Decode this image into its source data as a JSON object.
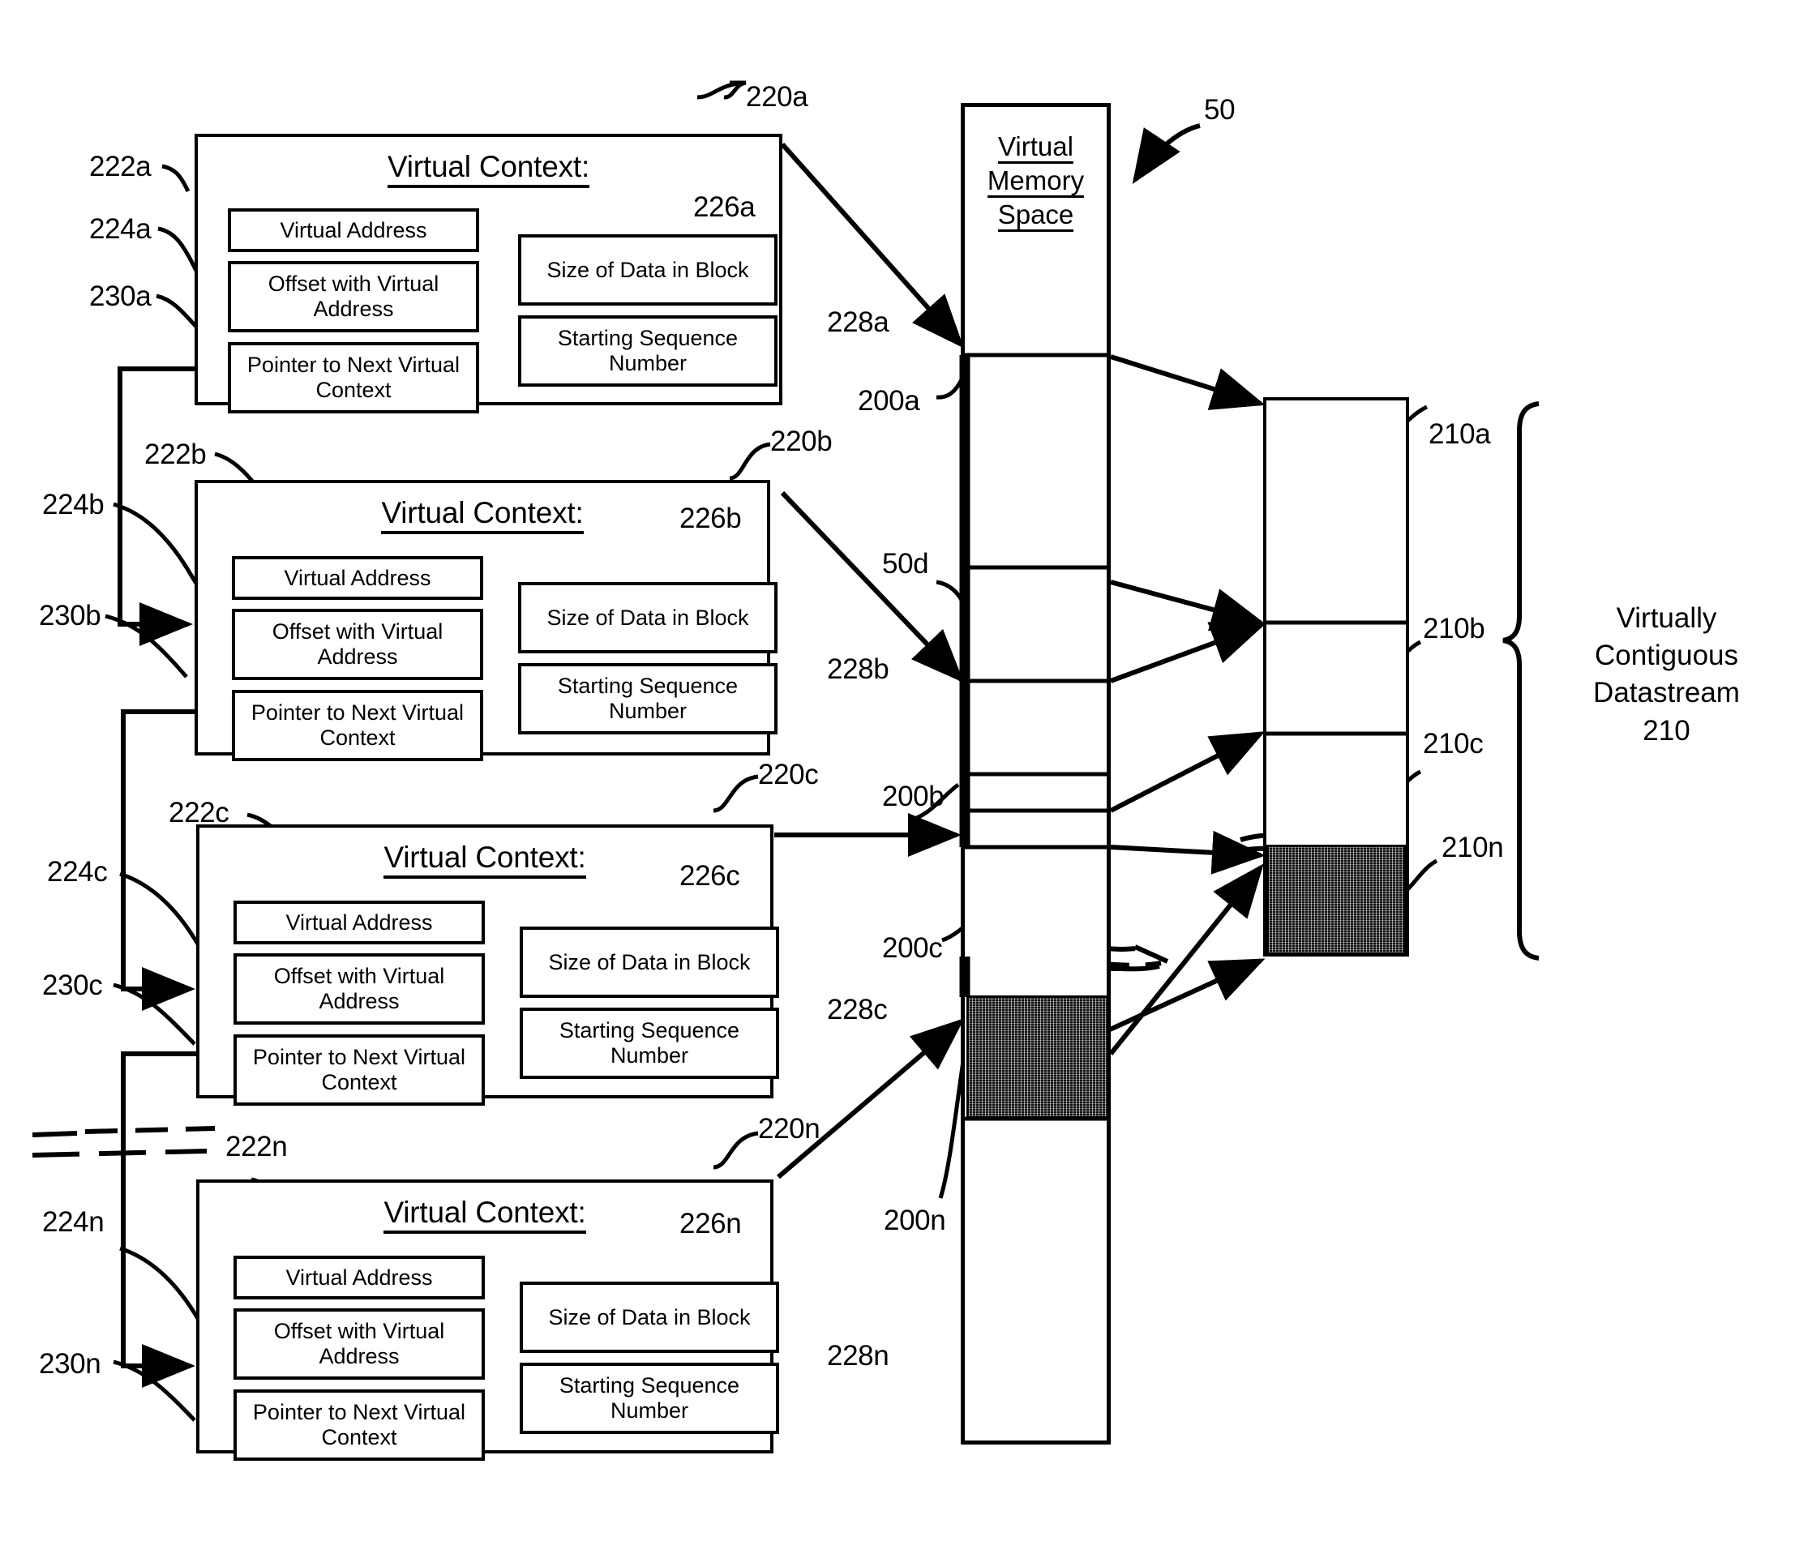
{
  "figure": {
    "type": "patent-diagram",
    "system_ref": "50"
  },
  "virtual_contexts": [
    {
      "id": "a",
      "title": "Virtual Context:",
      "ref_card": "220a",
      "ref_title": "222a",
      "ref_virtual_address": "224a",
      "ref_pointer": "230a",
      "ref_size": "226a",
      "ref_sequence": "228a",
      "field_virtual_address": "Virtual Address",
      "field_offset": "Offset with Virtual Address",
      "field_pointer": "Pointer to Next Virtual Context",
      "field_size": "Size of Data in Block",
      "field_sequence": "Starting Sequence Number"
    },
    {
      "id": "b",
      "title": "Virtual Context:",
      "ref_card": "220b",
      "ref_title": "222b",
      "ref_virtual_address": "224b",
      "ref_pointer": "230b",
      "ref_size": "226b",
      "ref_sequence": "228b",
      "field_virtual_address": "Virtual Address",
      "field_offset": "Offset with Virtual Address",
      "field_pointer": "Pointer to Next Virtual Context",
      "field_size": "Size of Data in Block",
      "field_sequence": "Starting Sequence Number"
    },
    {
      "id": "c",
      "title": "Virtual Context:",
      "ref_card": "220c",
      "ref_title": "222c",
      "ref_virtual_address": "224c",
      "ref_pointer": "230c",
      "ref_size": "226c",
      "ref_sequence": "228c",
      "field_virtual_address": "Virtual Address",
      "field_offset": "Offset with Virtual Address",
      "field_pointer": "Pointer to Next Virtual Context",
      "field_size": "Size of Data in Block",
      "field_sequence": "Starting Sequence Number"
    },
    {
      "id": "n",
      "title": "Virtual Context:",
      "ref_card": "220n",
      "ref_title": "222n",
      "ref_virtual_address": "224n",
      "ref_pointer": "230n",
      "ref_size": "226n",
      "ref_sequence": "228n",
      "field_virtual_address": "Virtual Address",
      "field_offset": "Offset with Virtual Address",
      "field_pointer": "Pointer to Next Virtual Context",
      "field_size": "Size of Data in Block",
      "field_sequence": "Starting Sequence Number"
    }
  ],
  "memory": {
    "heading_line1": "Virtual",
    "heading_line2": "Memory",
    "heading_line3": "Space",
    "block_refs": [
      "200a",
      "50d",
      "200b",
      "200c",
      "200n"
    ]
  },
  "datastream": {
    "segment_refs": [
      "210a",
      "210b",
      "210c",
      "210n"
    ],
    "bracket_label": "Virtually\nContiguous\nDatastream\n210"
  }
}
